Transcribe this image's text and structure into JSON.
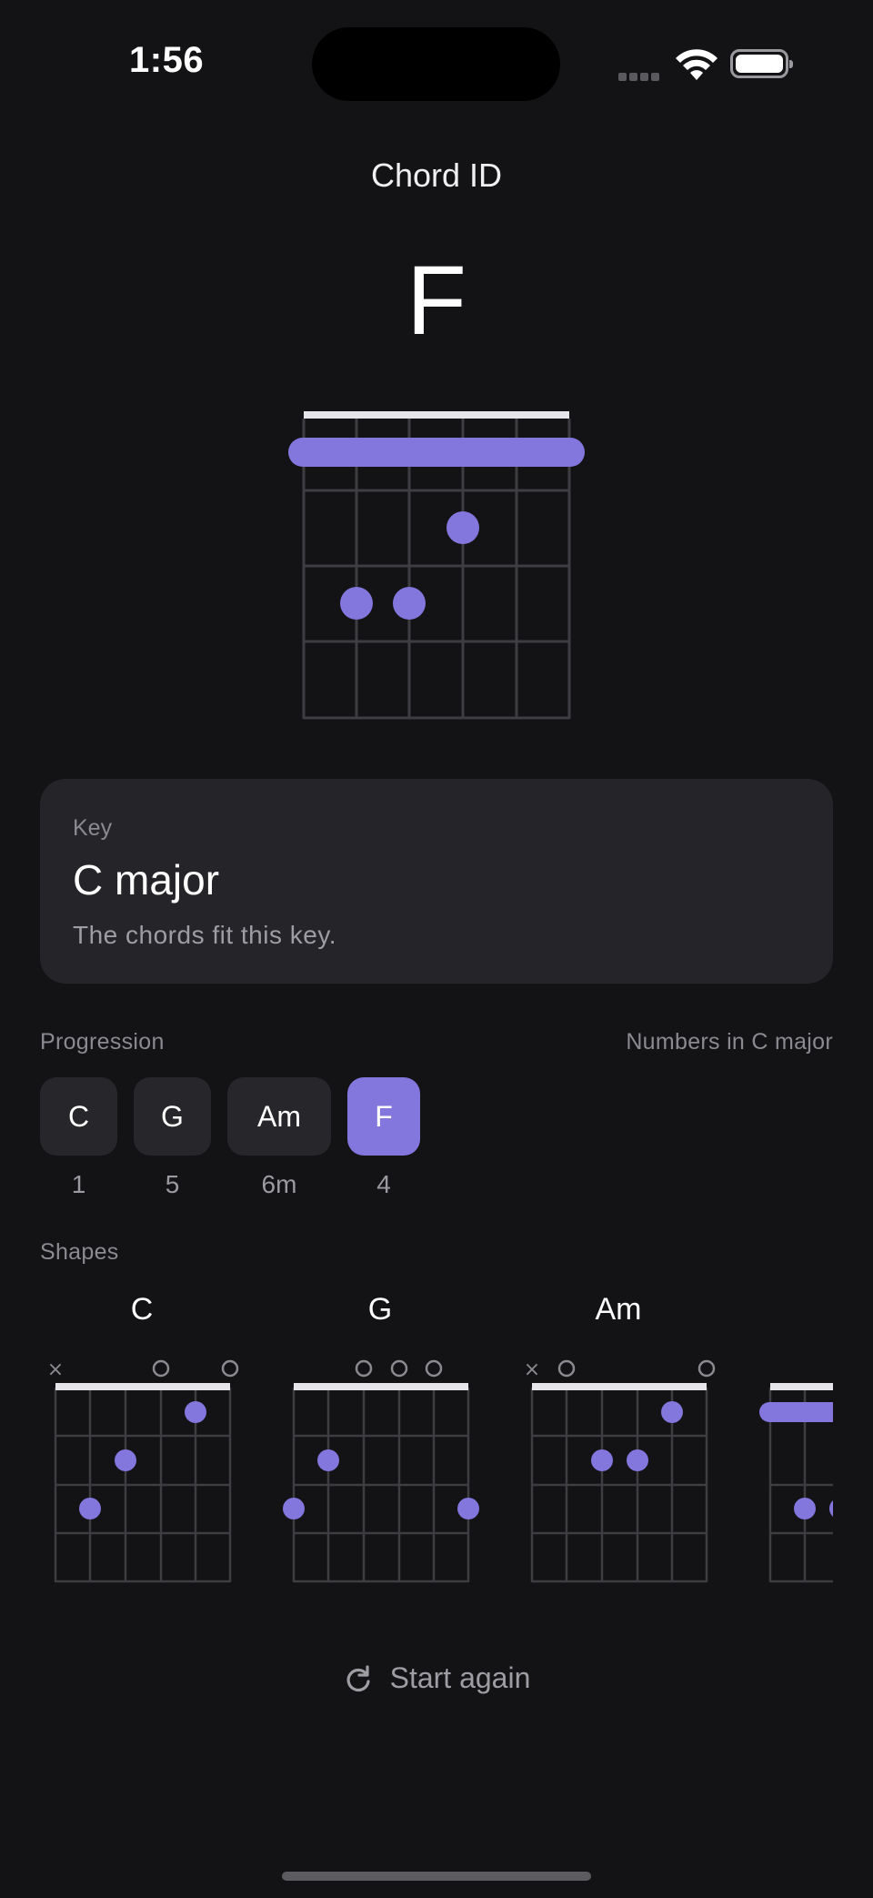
{
  "status_bar": {
    "time": "1:56"
  },
  "header": {
    "title": "Chord ID"
  },
  "current_chord": {
    "name": "F"
  },
  "key_card": {
    "label": "Key",
    "value": "C major",
    "description": "The chords fit this key."
  },
  "progression": {
    "label": "Progression",
    "numbers_label": "Numbers in C major",
    "chords": [
      {
        "name": "C",
        "degree": "1",
        "active": false
      },
      {
        "name": "G",
        "degree": "5",
        "active": false
      },
      {
        "name": "Am",
        "degree": "6m",
        "active": false
      },
      {
        "name": "F",
        "degree": "4",
        "active": true
      }
    ]
  },
  "shapes": {
    "label": "Shapes",
    "items": [
      {
        "name": "C"
      },
      {
        "name": "G"
      },
      {
        "name": "Am"
      }
    ]
  },
  "actions": {
    "start_again": "Start again"
  },
  "colors": {
    "accent": "#8377de",
    "background": "#131315",
    "card": "#252529"
  },
  "icons": {
    "restart": "refresh-icon",
    "wifi": "wifi-icon",
    "battery": "battery-icon"
  }
}
